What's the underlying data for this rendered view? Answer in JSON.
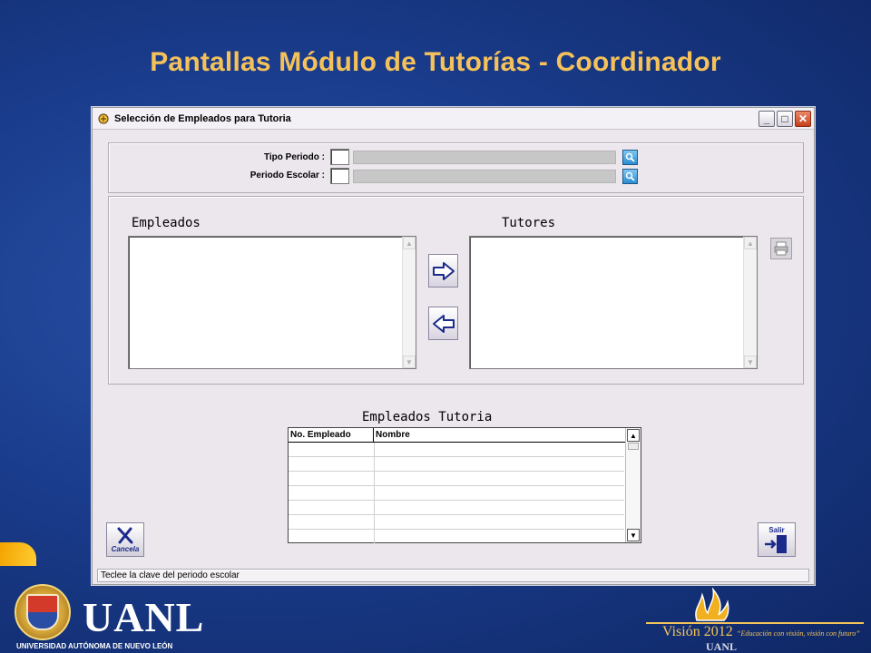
{
  "slide": {
    "title": "Pantallas Módulo de Tutorías - Coordinador"
  },
  "window": {
    "title": "Selección de Empleados para Tutoria",
    "controls": [
      "minimize-icon",
      "maximize-icon",
      "close-icon"
    ]
  },
  "filters": {
    "tipo_periodo_label": "Tipo Periodo :",
    "periodo_escolar_label": "Periodo Escolar :",
    "tipo_periodo_value": "",
    "periodo_escolar_value": ""
  },
  "lists": {
    "empleados_label": "Empleados",
    "tutores_label": "Tutores",
    "empleados_items": [],
    "tutores_items": []
  },
  "tutoria_grid": {
    "caption": "Empleados Tutoria",
    "columns": [
      "No. Empleado",
      "Nombre"
    ],
    "rows": [
      [
        "",
        ""
      ],
      [
        "",
        ""
      ],
      [
        "",
        ""
      ],
      [
        "",
        ""
      ],
      [
        "",
        ""
      ],
      [
        "",
        ""
      ]
    ]
  },
  "buttons": {
    "cancel_label": "Cancela",
    "exit_label": "Salir"
  },
  "status": {
    "message": "Teclee la clave del periodo escolar"
  },
  "footer": {
    "uanl": "UANL",
    "uanl_full": "UNIVERSIDAD AUTÓNOMA DE NUEVO LEÓN",
    "vision_title": "Visión 2012",
    "vision_quote": "“Educación con visión, visión con futuro”",
    "vision_uanl": "UANL"
  },
  "colors": {
    "title": "#f5c15a",
    "background": "#1a3c8c",
    "window_bg": "#ece6ed"
  }
}
